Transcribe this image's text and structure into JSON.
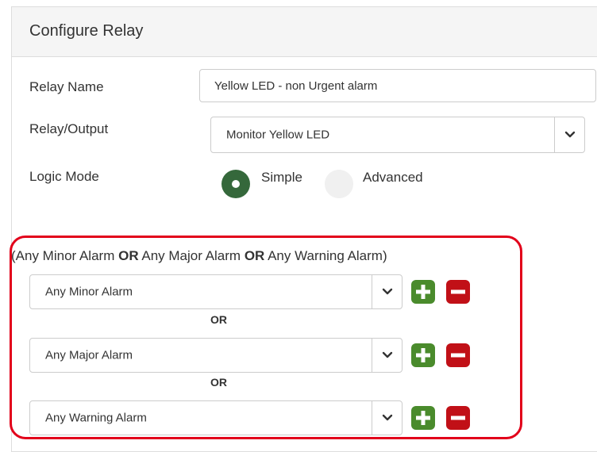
{
  "panel": {
    "title": "Configure Relay"
  },
  "form": {
    "relay_name_label": "Relay Name",
    "relay_name_value": "Yellow LED - non Urgent alarm",
    "relay_output_label": "Relay/Output",
    "relay_output_value": "Monitor Yellow LED",
    "logic_mode_label": "Logic Mode",
    "logic_mode_options": [
      {
        "label": "Simple",
        "selected": true
      },
      {
        "label": "Advanced",
        "selected": false
      }
    ]
  },
  "logic": {
    "expression_parts": [
      "(Any Minor Alarm ",
      "OR",
      " Any Major Alarm ",
      "OR",
      " Any Warning Alarm)"
    ],
    "conditions": [
      {
        "value": "Any Minor Alarm"
      },
      {
        "value": "Any Major Alarm"
      },
      {
        "value": "Any Warning Alarm"
      }
    ],
    "operator_label": "OR"
  },
  "icons": {
    "dropdown": "chevron-down-icon",
    "add": "plus-icon",
    "remove": "minus-icon"
  },
  "colors": {
    "radio_selected": "#35683b",
    "add_button": "#4a8b2c",
    "remove_button": "#c11017",
    "highlight_border": "#e2001a"
  }
}
